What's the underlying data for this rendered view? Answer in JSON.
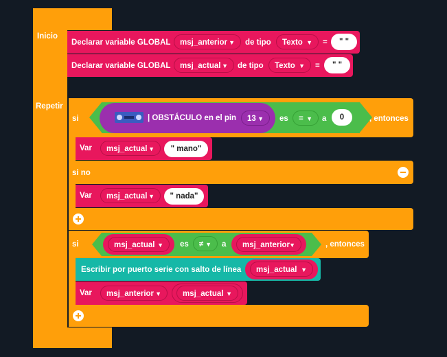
{
  "main": {
    "inicio_label": "Inicio",
    "repetir_label": "Repetir"
  },
  "declare1": {
    "label": "Declarar variable GLOBAL",
    "var_name": "msj_anterior",
    "de_tipo": "de tipo",
    "type": "Texto",
    "equals": "=",
    "value": "\"  \""
  },
  "declare2": {
    "label": "Declarar variable GLOBAL",
    "var_name": "msj_actual",
    "de_tipo": "de tipo",
    "type": "Texto",
    "equals": "=",
    "value": "\"  \""
  },
  "if1": {
    "si": "si",
    "sensor": "| OBSTÁCULO en el pin",
    "pin": "13",
    "es": "es",
    "op": "=",
    "a": "a",
    "compare_value": "0",
    "entonces": ", entonces",
    "set1_label": "Var",
    "set1_var": "msj_actual",
    "set1_value": "\" mano\"",
    "else_label": "si no",
    "set2_label": "Var",
    "set2_var": "msj_actual",
    "set2_value": "\" nada\""
  },
  "if2": {
    "si": "si",
    "left_var": "msj_actual",
    "es": "es",
    "op": "≠",
    "a": "a",
    "right_var": "msj_anterior",
    "entonces": ", entonces",
    "serial_label": "Escribir por puerto serie con salto de línea",
    "serial_var": "msj_actual",
    "set_label": "Var",
    "set_var": "msj_anterior",
    "set_value": "msj_actual"
  },
  "icons": {
    "dropdown": "▼",
    "minus": "minus-circle-icon",
    "plus": "plus-circle-icon",
    "sensor": "obstacle-sensor-icon"
  },
  "colors": {
    "background": "#121a24",
    "control": "#ff9f0a",
    "variables": "#e8175d",
    "logic": "#4bbd4b",
    "sensor": "#9b2fae",
    "serial": "#16b8a7"
  }
}
